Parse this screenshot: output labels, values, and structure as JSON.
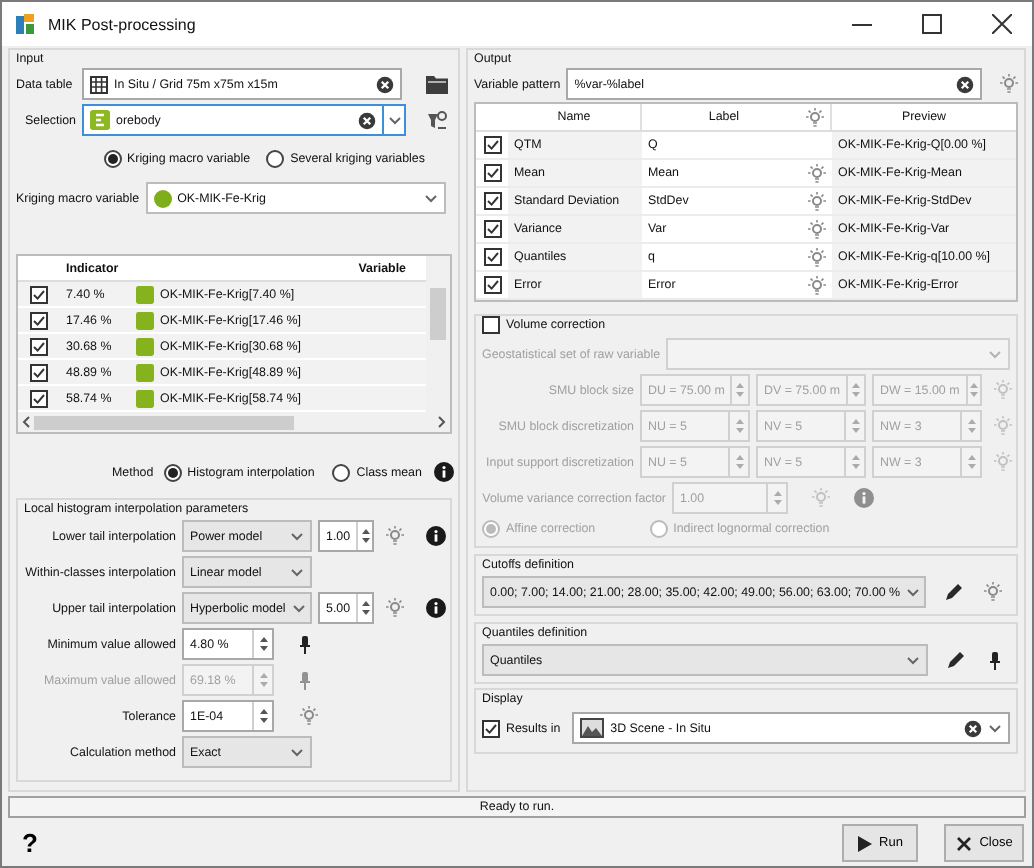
{
  "window": {
    "title": "MIK Post-processing"
  },
  "input": {
    "title": "Input",
    "data_table": {
      "label": "Data table",
      "value": "In Situ / Grid 75m x75m x15m"
    },
    "selection": {
      "label": "Selection",
      "value": "orebody"
    },
    "mode_options": [
      {
        "label": "Kriging macro variable",
        "selected": true
      },
      {
        "label": "Several kriging variables",
        "selected": false
      }
    ],
    "kriging_macro_variable": {
      "label": "Kriging macro variable",
      "value": "OK-MIK-Fe-Krig"
    },
    "indicator_table": {
      "columns": [
        "Indicator",
        "Variable"
      ],
      "rows": [
        {
          "checked": true,
          "indicator": "7.40 %",
          "variable": "OK-MIK-Fe-Krig[7.40 %]"
        },
        {
          "checked": true,
          "indicator": "17.46 %",
          "variable": "OK-MIK-Fe-Krig[17.46 %]"
        },
        {
          "checked": true,
          "indicator": "30.68 %",
          "variable": "OK-MIK-Fe-Krig[30.68 %]"
        },
        {
          "checked": true,
          "indicator": "48.89 %",
          "variable": "OK-MIK-Fe-Krig[48.89 %]"
        },
        {
          "checked": true,
          "indicator": "58.74 %",
          "variable": "OK-MIK-Fe-Krig[58.74 %]"
        }
      ]
    },
    "method": {
      "label": "Method",
      "options": [
        {
          "label": "Histogram interpolation",
          "selected": true
        },
        {
          "label": "Class mean",
          "selected": false
        }
      ]
    },
    "interpolation": {
      "title": "Local histogram interpolation parameters",
      "rows": [
        {
          "kind": "combo_spin",
          "label": "Lower tail interpolation",
          "value": "Power model",
          "number": "1.00"
        },
        {
          "kind": "combo",
          "label": "Within-classes interpolation",
          "value": "Linear model"
        },
        {
          "kind": "combo_spin",
          "label": "Upper tail interpolation",
          "value": "Hyperbolic model",
          "number": "5.00"
        },
        {
          "kind": "spin",
          "label": "Minimum value allowed",
          "value": "4.80 %",
          "disabled": false
        },
        {
          "kind": "spin",
          "label": "Maximum value allowed",
          "value": "69.18 %",
          "disabled": true
        },
        {
          "kind": "spin",
          "label": "Tolerance",
          "value": "1E-04",
          "disabled": false
        },
        {
          "kind": "combo",
          "label": "Calculation method",
          "value": "Exact"
        }
      ]
    }
  },
  "output": {
    "title": "Output",
    "variable_pattern": {
      "label": "Variable pattern",
      "value": "%var-%label"
    },
    "statistics_table": {
      "columns": [
        "Name",
        "Label",
        "Preview"
      ],
      "rows": [
        {
          "checked": true,
          "name": "QTM",
          "label": "Q",
          "preview": "OK-MIK-Fe-Krig-Q[0.00 %]"
        },
        {
          "checked": true,
          "name": "Mean",
          "label": "Mean",
          "preview": "OK-MIK-Fe-Krig-Mean"
        },
        {
          "checked": true,
          "name": "Standard Deviation",
          "label": "StdDev",
          "preview": "OK-MIK-Fe-Krig-StdDev"
        },
        {
          "checked": true,
          "name": "Variance",
          "label": "Var",
          "preview": "OK-MIK-Fe-Krig-Var"
        },
        {
          "checked": true,
          "name": "Quantiles",
          "label": "q",
          "preview": "OK-MIK-Fe-Krig-q[10.00 %]"
        },
        {
          "checked": true,
          "name": "Error",
          "label": "Error",
          "preview": "OK-MIK-Fe-Krig-Error"
        }
      ]
    },
    "volume_correction": {
      "label": "Volume correction",
      "checked": false,
      "raw_variable_set": {
        "label": "Geostatistical set of raw variable"
      },
      "grid_rows": [
        {
          "label": "SMU block size",
          "values": [
            "DU = 75.00 m",
            "DV = 75.00 m",
            "DW = 15.00 m"
          ]
        },
        {
          "label": "SMU block discretization",
          "values": [
            "NU = 5",
            "NV = 5",
            "NW = 3"
          ]
        },
        {
          "label": "Input support discretization",
          "values": [
            "NU = 5",
            "NV = 5",
            "NW = 3"
          ]
        }
      ],
      "variance_factor": {
        "label": "Volume variance correction factor",
        "value": "1.00"
      },
      "correction_options": [
        {
          "label": "Affine correction",
          "selected": true
        },
        {
          "label": "Indirect lognormal correction",
          "selected": false
        }
      ]
    },
    "cutoffs": {
      "title": "Cutoffs definition",
      "value": "0.00; 7.00; 14.00; 21.00; 28.00; 35.00; 42.00; 49.00; 56.00; 63.00; 70.00 %"
    },
    "quantiles": {
      "title": "Quantiles definition",
      "value": "Quantiles"
    },
    "display": {
      "title": "Display",
      "results_in": {
        "label": "Results in",
        "checked": true,
        "value": "3D Scene - In Situ"
      }
    }
  },
  "status_bar": {
    "text": "Ready to run."
  },
  "help": "?",
  "buttons": [
    {
      "label": "Run"
    },
    {
      "label": "Close"
    }
  ]
}
